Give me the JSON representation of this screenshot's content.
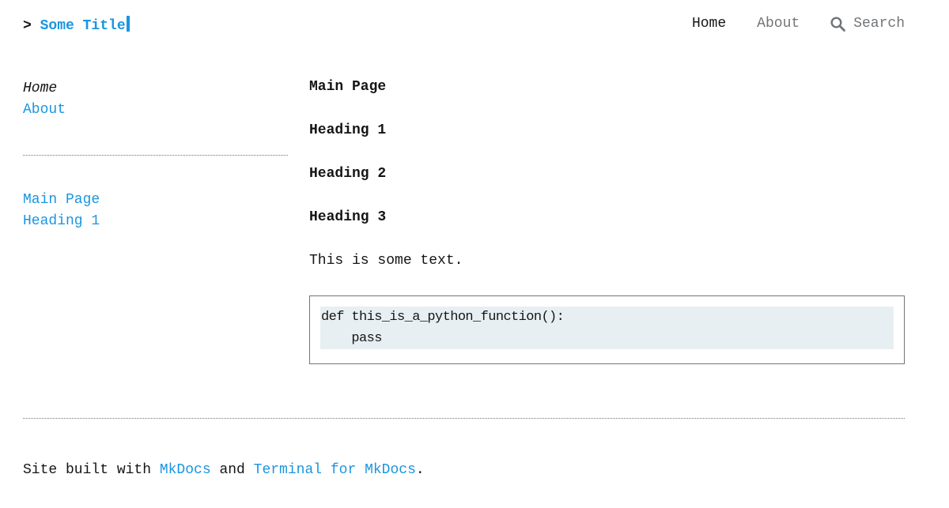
{
  "header": {
    "prompt": ">",
    "site_title": "Some Title"
  },
  "topnav": {
    "items": [
      {
        "label": "Home",
        "active": true
      },
      {
        "label": "About",
        "active": false
      }
    ],
    "search_label": "Search",
    "search_icon": "magnifier-icon"
  },
  "sidebar": {
    "nav": [
      {
        "label": "Home",
        "current": true
      },
      {
        "label": "About",
        "current": false
      }
    ],
    "toc": [
      {
        "label": "Main Page"
      },
      {
        "label": "Heading 1"
      }
    ]
  },
  "main": {
    "title": "Main Page",
    "headings": [
      "Heading 1",
      "Heading 2",
      "Heading 3"
    ],
    "text": "This is some text.",
    "code": "def this_is_a_python_function():\n    pass"
  },
  "footer": {
    "prefix": "Site built with ",
    "link1": "MkDocs",
    "middle": " and ",
    "link2": "Terminal for MkDocs",
    "suffix": "."
  },
  "colors": {
    "accent": "#1a95e0",
    "text": "#151515",
    "muted": "#727578",
    "code_bg": "#e8eff2"
  }
}
